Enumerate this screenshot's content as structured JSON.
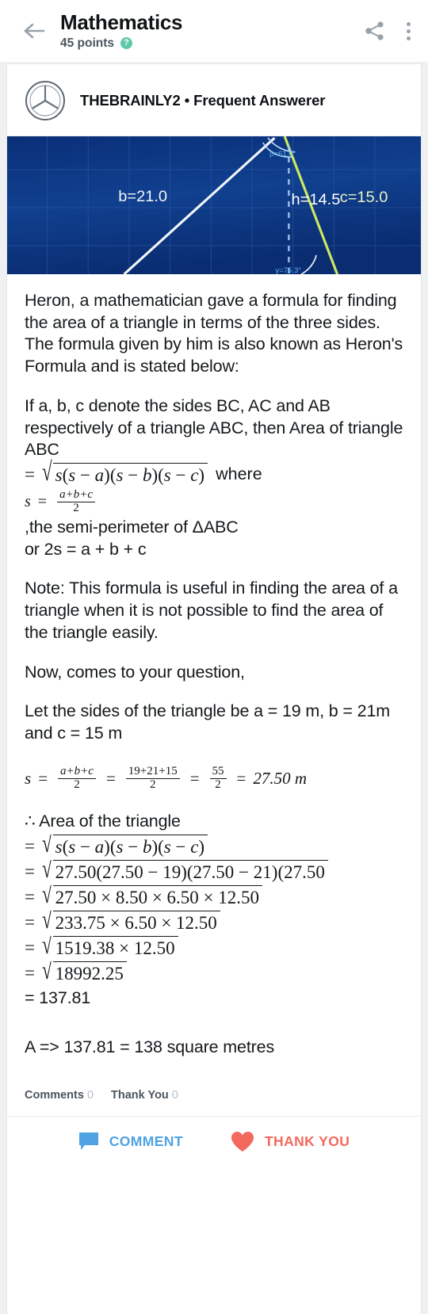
{
  "header": {
    "back_icon": "arrow-left-icon",
    "title": "Mathematics",
    "points": "45 points",
    "help_badge": "?",
    "share_icon": "share-icon",
    "more_icon": "more-vertical-icon"
  },
  "answer": {
    "avatar_icon": "user-avatar-icon",
    "author": "THEBRAINLY2 • Frequent Answerer"
  },
  "diagram": {
    "label_b": "b=21.0",
    "label_h": "h=14.5",
    "label_c": "c=15.0",
    "label_beta": "β=61.0°",
    "label_gamma": "γ=75.3°",
    "bg_color": "#0c337e",
    "side_color": "#ffffff",
    "c_color": "#cfe860"
  },
  "body": {
    "p1": "Heron, a mathematician gave a formula for finding the area of a triangle in terms of the three sides. The formula given by him is also known as Heron's Formula and is stated below:",
    "p2": "If a, b, c denote the sides BC, AC and AB respectively of a triangle ABC, then Area of triangle ABC",
    "formula_area_eq": "= √s(s − a)(s − b)(s − c)",
    "formula_area_tail": "where",
    "formula_s": "s = (a+b+c)/2",
    "p3": ",the semi-perimeter of ΔABC",
    "p4": "or 2s = a + b + c",
    "p5": "Note: This formula is useful in finding the area of a triangle when it is not possible to find the area of the triangle easily.",
    "p6": "Now, comes to your question,",
    "p7": "Let the sides of the triangle be a = 19 m, b = 21m and c = 15 m",
    "s_line": {
      "s": "s",
      "f1_num": "a+b+c",
      "f1_den": "2",
      "f2_num": "19+21+15",
      "f2_den": "2",
      "f3_num": "55",
      "f3_den": "2",
      "result": "27.50 m"
    },
    "area_heading": "∴ Area of the triangle",
    "steps": [
      "s(s − a)(s − b)(s − c)",
      "27.50(27.50 − 19)(27.50 − 21)(27.50",
      "27.50 × 8.50 × 6.50 × 12.50",
      "233.75 × 6.50 × 12.50",
      "1519.38 × 12.50",
      "18992.25"
    ],
    "final_value": "= 137.81",
    "conclusion": "A => 137.81 = 138 square metres"
  },
  "footer": {
    "comments_label": "Comments",
    "comments_count": "0",
    "thanks_label": "Thank You",
    "thanks_count": "0",
    "comment_button": "COMMENT",
    "thank_button": "THANK YOU",
    "comment_icon": "speech-bubble-icon",
    "thank_icon": "heart-icon",
    "comment_color": "#4fa3e3",
    "thank_color": "#f4695e"
  }
}
